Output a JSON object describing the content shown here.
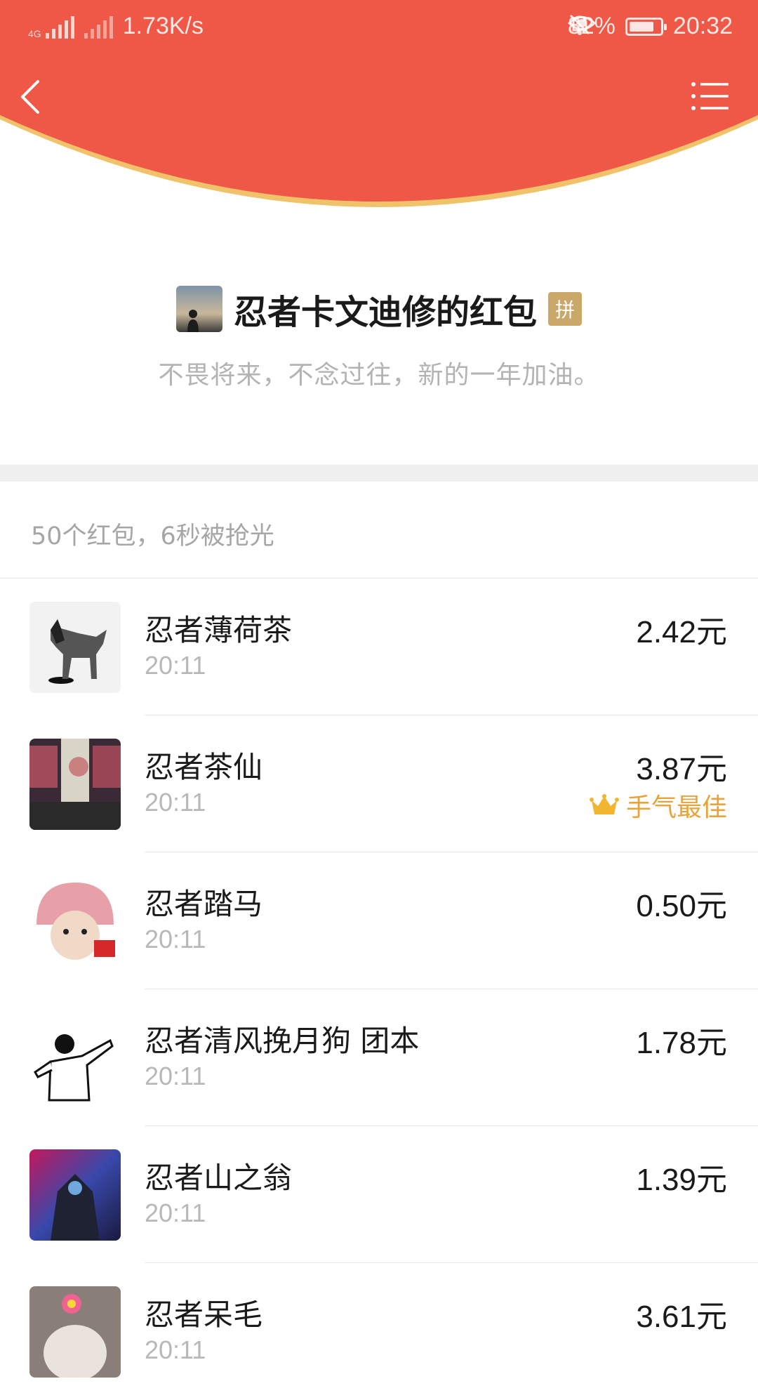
{
  "status_bar": {
    "network_speed": "1.73K/s",
    "network_type": "4G",
    "battery_percent": "82%",
    "time": "20:32"
  },
  "header": {
    "color": "#ef5846",
    "back_icon": "chevron-left-icon",
    "menu_icon": "list-menu-icon"
  },
  "sender": {
    "name": "忍者卡文迪修的红包",
    "badge": "拼",
    "message": "不畏将来，不念过往，新的一年加油。"
  },
  "summary": "50个红包，6秒被抢光",
  "best_label": "手气最佳",
  "accent_colors": {
    "best": "#e9a33b",
    "badge": "#c9a86a"
  },
  "records": [
    {
      "name": "忍者薄荷茶",
      "time": "20:11",
      "amount": "2.42元",
      "best": false
    },
    {
      "name": "忍者茶仙",
      "time": "20:11",
      "amount": "3.87元",
      "best": true
    },
    {
      "name": "忍者踏马",
      "time": "20:11",
      "amount": "0.50元",
      "best": false
    },
    {
      "name": "忍者清风挽月狗 团本",
      "time": "20:11",
      "amount": "1.78元",
      "best": false
    },
    {
      "name": "忍者山之翁",
      "time": "20:11",
      "amount": "1.39元",
      "best": false
    },
    {
      "name": "忍者呆毛",
      "time": "20:11",
      "amount": "3.61元",
      "best": false
    }
  ]
}
